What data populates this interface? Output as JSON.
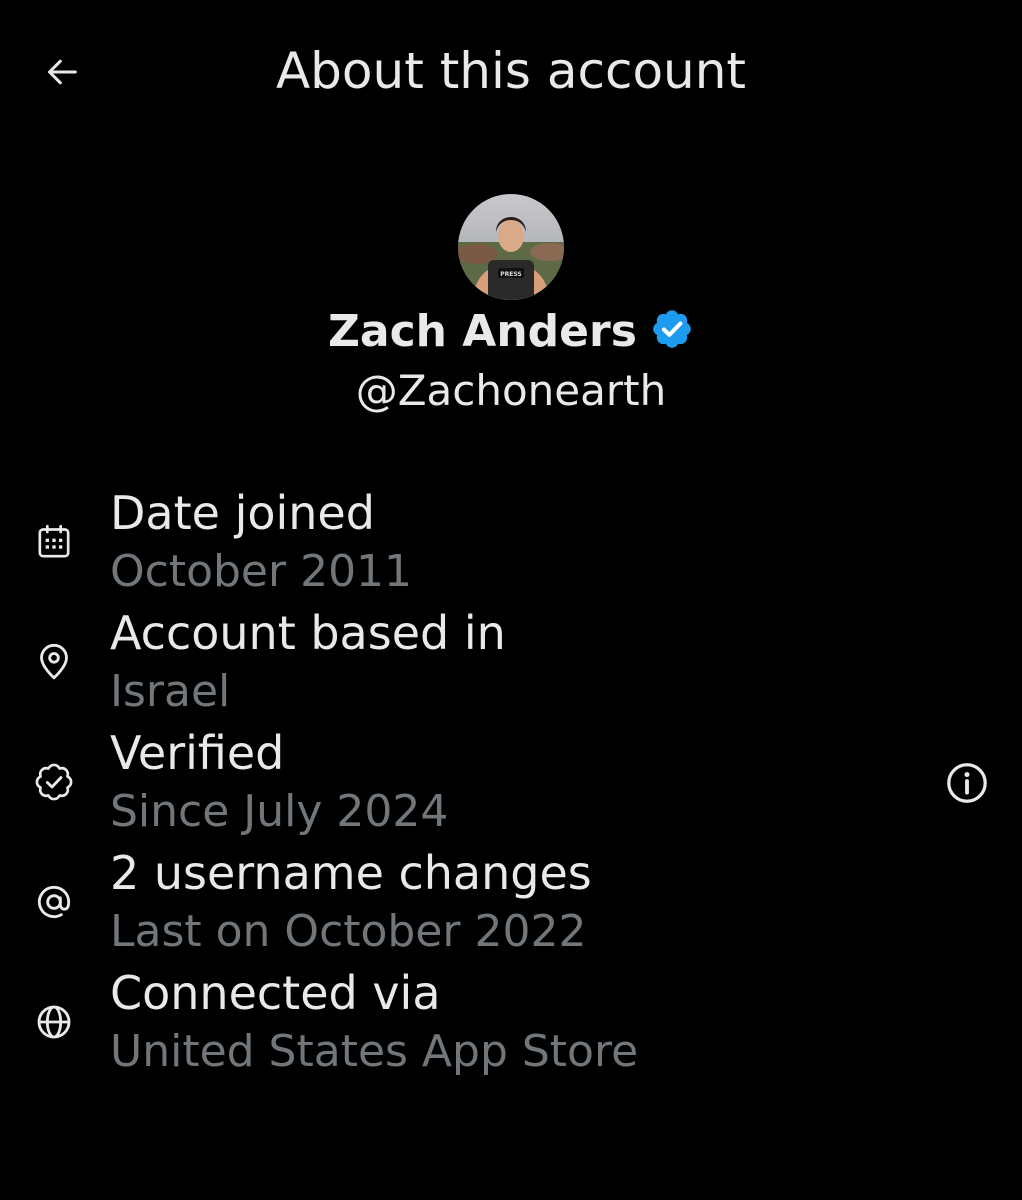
{
  "header": {
    "title": "About this account",
    "back_icon": "arrow-left-icon"
  },
  "profile": {
    "name": "Zach Anders",
    "handle": "@Zachonearth",
    "verified_badge_color": "#1d9bf0",
    "avatar_patch_text": "PRESS"
  },
  "info_items": [
    {
      "icon": "calendar-icon",
      "label": "Date joined",
      "value": "October 2011"
    },
    {
      "icon": "location-pin-icon",
      "label": "Account based in",
      "value": "Israel"
    },
    {
      "icon": "verified-outline-icon",
      "label": "Verified",
      "value": "Since July 2024",
      "has_info_button": true
    },
    {
      "icon": "at-sign-icon",
      "label": "2 username changes",
      "value": "Last on October 2022"
    },
    {
      "icon": "globe-icon",
      "label": "Connected via",
      "value": "United States App Store"
    }
  ],
  "colors": {
    "background": "#000000",
    "primary_text": "#e7e9ea",
    "secondary_text": "#71767b",
    "accent": "#1d9bf0"
  }
}
